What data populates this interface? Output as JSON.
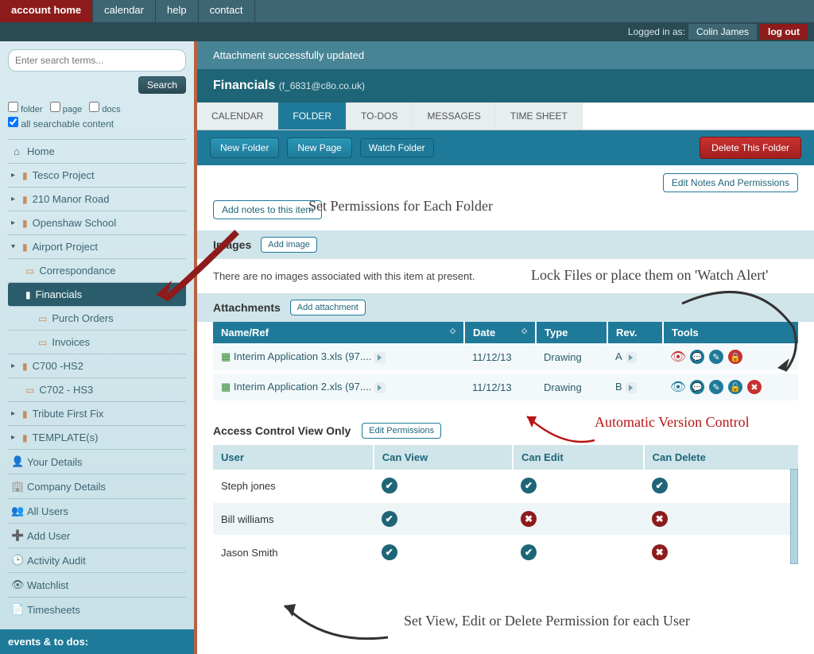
{
  "topnav": {
    "tabs": [
      "account home",
      "calendar",
      "help",
      "contact"
    ],
    "active": 0
  },
  "loginbar": {
    "label": "Logged in as:",
    "user": "Colin James",
    "logout": "log out"
  },
  "search": {
    "placeholder": "Enter search terms...",
    "button": "Search",
    "filters": {
      "folder": "folder",
      "page": "page",
      "docs": "docs",
      "all": "all searchable content"
    }
  },
  "sidenav": [
    {
      "icon": "home",
      "label": "Home"
    },
    {
      "icon": "folder",
      "caret": "▸",
      "label": "Tesco Project"
    },
    {
      "icon": "folder",
      "caret": "▸",
      "label": "210 Manor Road"
    },
    {
      "icon": "folder",
      "caret": "▸",
      "label": "Openshaw School"
    },
    {
      "icon": "folder",
      "caret": "▾",
      "label": "Airport Project"
    },
    {
      "icon": "folder",
      "sub": true,
      "label": "Correspondance"
    },
    {
      "icon": "folder",
      "sub": true,
      "selected": true,
      "label": "Financials"
    },
    {
      "icon": "folder",
      "sub2": true,
      "label": "Purch Orders"
    },
    {
      "icon": "folder",
      "sub2": true,
      "label": "Invoices"
    },
    {
      "icon": "folder",
      "caret": "▸",
      "label": "C700 -HS2"
    },
    {
      "icon": "folder",
      "sub": true,
      "label": "C702 - HS3"
    },
    {
      "icon": "folder",
      "caret": "▸",
      "label": "Tribute First Fix"
    },
    {
      "icon": "folder",
      "caret": "▸",
      "label": "TEMPLATE(s)"
    },
    {
      "icon": "person",
      "label": "Your Details"
    },
    {
      "icon": "building",
      "label": "Company Details"
    },
    {
      "icon": "users",
      "label": "All Users"
    },
    {
      "icon": "adduser",
      "label": "Add User"
    },
    {
      "icon": "clock",
      "label": "Activity Audit"
    },
    {
      "icon": "eye",
      "label": "Watchlist"
    },
    {
      "icon": "doc",
      "label": "Timesheets"
    }
  ],
  "events_label": "events & to dos:",
  "notice": "Attachment successfully updated",
  "page": {
    "title": "Financials",
    "subtitle": "(f_6831@c8o.co.uk)"
  },
  "ftabs": [
    "CALENDAR",
    "FOLDER",
    "TO-DOS",
    "MESSAGES",
    "TIME SHEET"
  ],
  "ftab_active": 1,
  "actions": {
    "new_folder": "New Folder",
    "new_page": "New Page",
    "watch_folder": "Watch Folder",
    "delete_folder": "Delete This Folder",
    "edit_notes_perm": "Edit Notes And Permissions",
    "add_notes": "Add notes to this item"
  },
  "images_section": {
    "title": "Images",
    "add": "Add image",
    "empty": "There are no images associated with this item at present."
  },
  "attachments_section": {
    "title": "Attachments",
    "add": "Add attachment",
    "cols": {
      "name": "Name/Ref",
      "date": "Date",
      "type": "Type",
      "rev": "Rev.",
      "tools": "Tools"
    },
    "rows": [
      {
        "name": "Interim Application 3.xls (97....",
        "date": "11/12/13",
        "type": "Drawing",
        "rev": "A",
        "locked": true,
        "deletable": false
      },
      {
        "name": "Interim Application 2.xls (97....",
        "date": "11/12/13",
        "type": "Drawing",
        "rev": "B",
        "locked": false,
        "deletable": true
      }
    ]
  },
  "acl_section": {
    "title": "Access Control View Only",
    "edit": "Edit Permissions",
    "cols": {
      "user": "User",
      "view": "Can View",
      "edit": "Can Edit",
      "del": "Can Delete"
    },
    "rows": [
      {
        "user": "Steph jones",
        "view": true,
        "edit": true,
        "del": true
      },
      {
        "user": "Bill williams",
        "view": true,
        "edit": false,
        "del": false
      },
      {
        "user": "Jason Smith",
        "view": true,
        "edit": true,
        "del": false
      }
    ]
  },
  "annotations": {
    "a1": "Set Permissions for Each Folder",
    "a2": "Lock Files or place them on 'Watch Alert'",
    "a3": "Automatic Version Control",
    "a4": "Set View, Edit or Delete Permission for each User"
  }
}
